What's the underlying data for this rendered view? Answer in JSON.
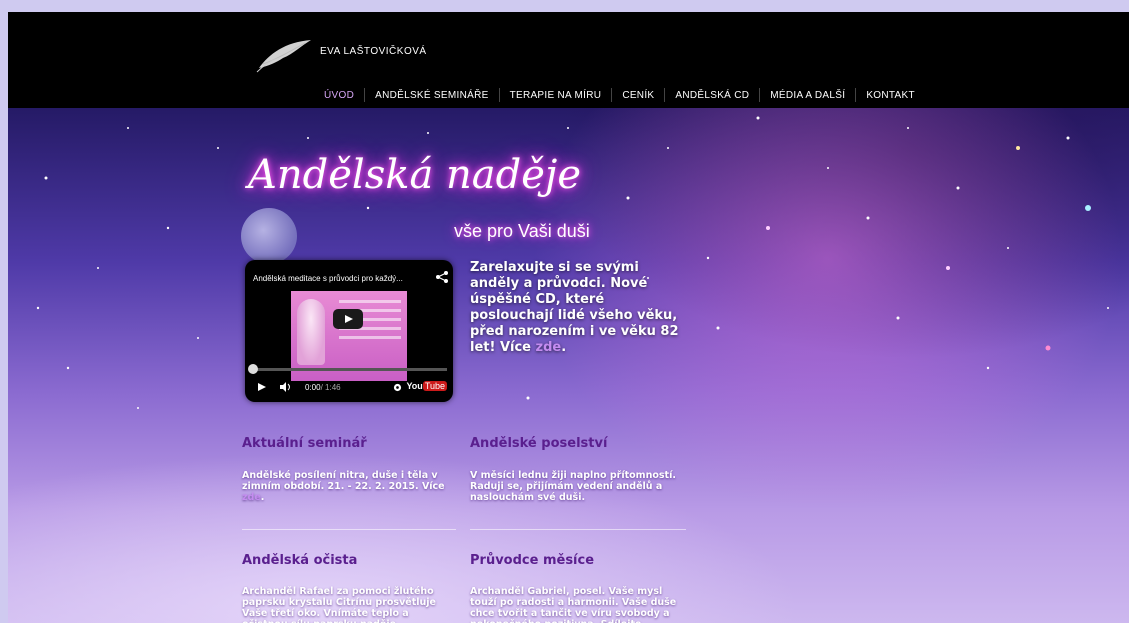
{
  "header": {
    "brand": "EVA LAŠTOVIČKOVÁ",
    "nav": [
      {
        "label": "ÚVOD",
        "active": true
      },
      {
        "label": "ANDĚLSKÉ SEMINÁŘE"
      },
      {
        "label": "TERAPIE NA MÍRU"
      },
      {
        "label": "CENÍK"
      },
      {
        "label": "ANDĚLSKÁ CD"
      },
      {
        "label": "MÉDIA A DALŠÍ"
      },
      {
        "label": "KONTAKT"
      }
    ]
  },
  "hero": {
    "title": "Andělská naděje",
    "subtitle": "vše pro Vaši duši"
  },
  "video": {
    "title": "Andělská meditace s průvodci pro každý...",
    "time_current": "0:00",
    "time_total": " / 1:46",
    "logo": "You",
    "logo_tube": "Tube"
  },
  "promo": {
    "text": "Zarelaxujte si se svými anděly a průvodci. Nové úspěšné CD, které poslouchají lidé všeho věku, před narozením i ve věku 82 let! Více ",
    "link": "zde",
    "end": "."
  },
  "sections": [
    {
      "title": "Aktuální seminář",
      "text": "Andělské posílení nitra, duše i těla v zimním období. 21. - 22. 2. 2015. Více ",
      "link": "zde",
      "end": "."
    },
    {
      "title": "Andělské poselství",
      "text": "V měsíci lednu žiji naplno přítomností. Raduji se, přijímám vedení andělů a naslouchám své duši."
    },
    {
      "title": "Andělská očista",
      "text": "Archanděl Rafael za pomoci žlutého paprsku krystalu Citrínu prosvětluje Vaše třetí oko. Vnímáte teplo a očistnou sílu paprsku naděje."
    },
    {
      "title": "Průvodce měsíce",
      "text": "Archanděl Gabriel, posel. Vaše mysl touží po radosti a harmonii. Vaše duše chce tvořit a tančit ve víru svobody a nekonečného pozitivna. Sdílejte"
    }
  ],
  "colors": {
    "nav_active": "#d6a6f5",
    "section_title": "#5a1f8e",
    "link": "#c48cf0"
  }
}
